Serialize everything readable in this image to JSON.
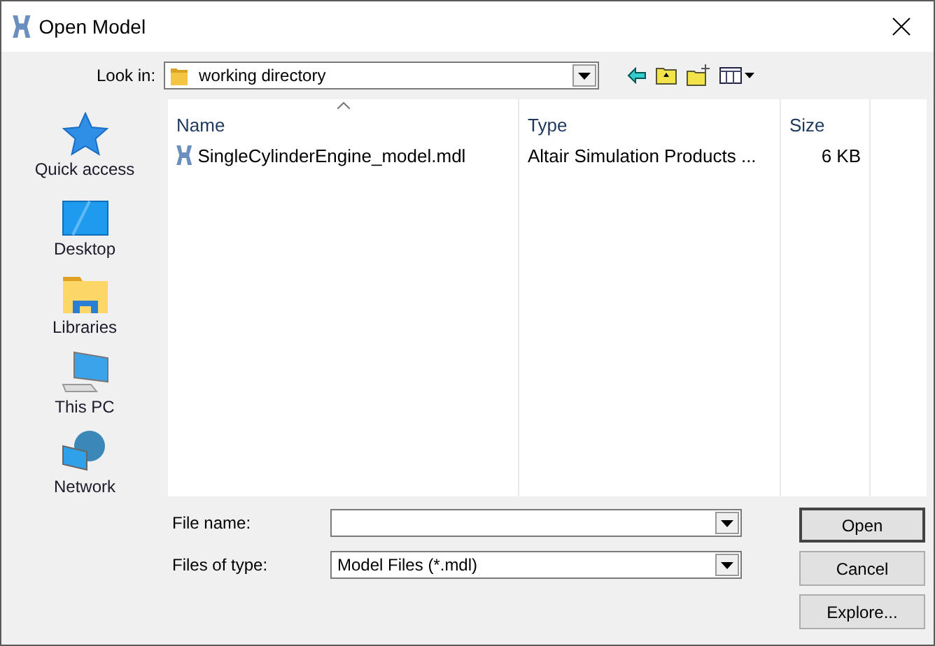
{
  "window": {
    "title": "Open Model"
  },
  "look_in": {
    "label": "Look in:",
    "value": "working directory"
  },
  "places": [
    {
      "kind": "star",
      "label": "Quick access"
    },
    {
      "kind": "desktop",
      "label": "Desktop"
    },
    {
      "kind": "libraries",
      "label": "Libraries"
    },
    {
      "kind": "pc",
      "label": "This PC"
    },
    {
      "kind": "network",
      "label": "Network"
    }
  ],
  "table": {
    "columns": [
      {
        "label": "Name",
        "sorted": true
      },
      {
        "label": "Type",
        "sorted": false
      },
      {
        "label": "Size",
        "sorted": false
      }
    ],
    "rows": [
      {
        "name": "SingleCylinderEngine_model.mdl",
        "type": "Altair Simulation Products ...",
        "size": "6 KB"
      }
    ]
  },
  "file_name": {
    "label": "File name:"
  },
  "file_type": {
    "label": "Files of type:",
    "value": "Model Files (*.mdl)"
  },
  "buttons": [
    {
      "label": "Open",
      "default": true
    },
    {
      "label": "Cancel",
      "default": false
    },
    {
      "label": "Explore...",
      "default": false
    }
  ]
}
